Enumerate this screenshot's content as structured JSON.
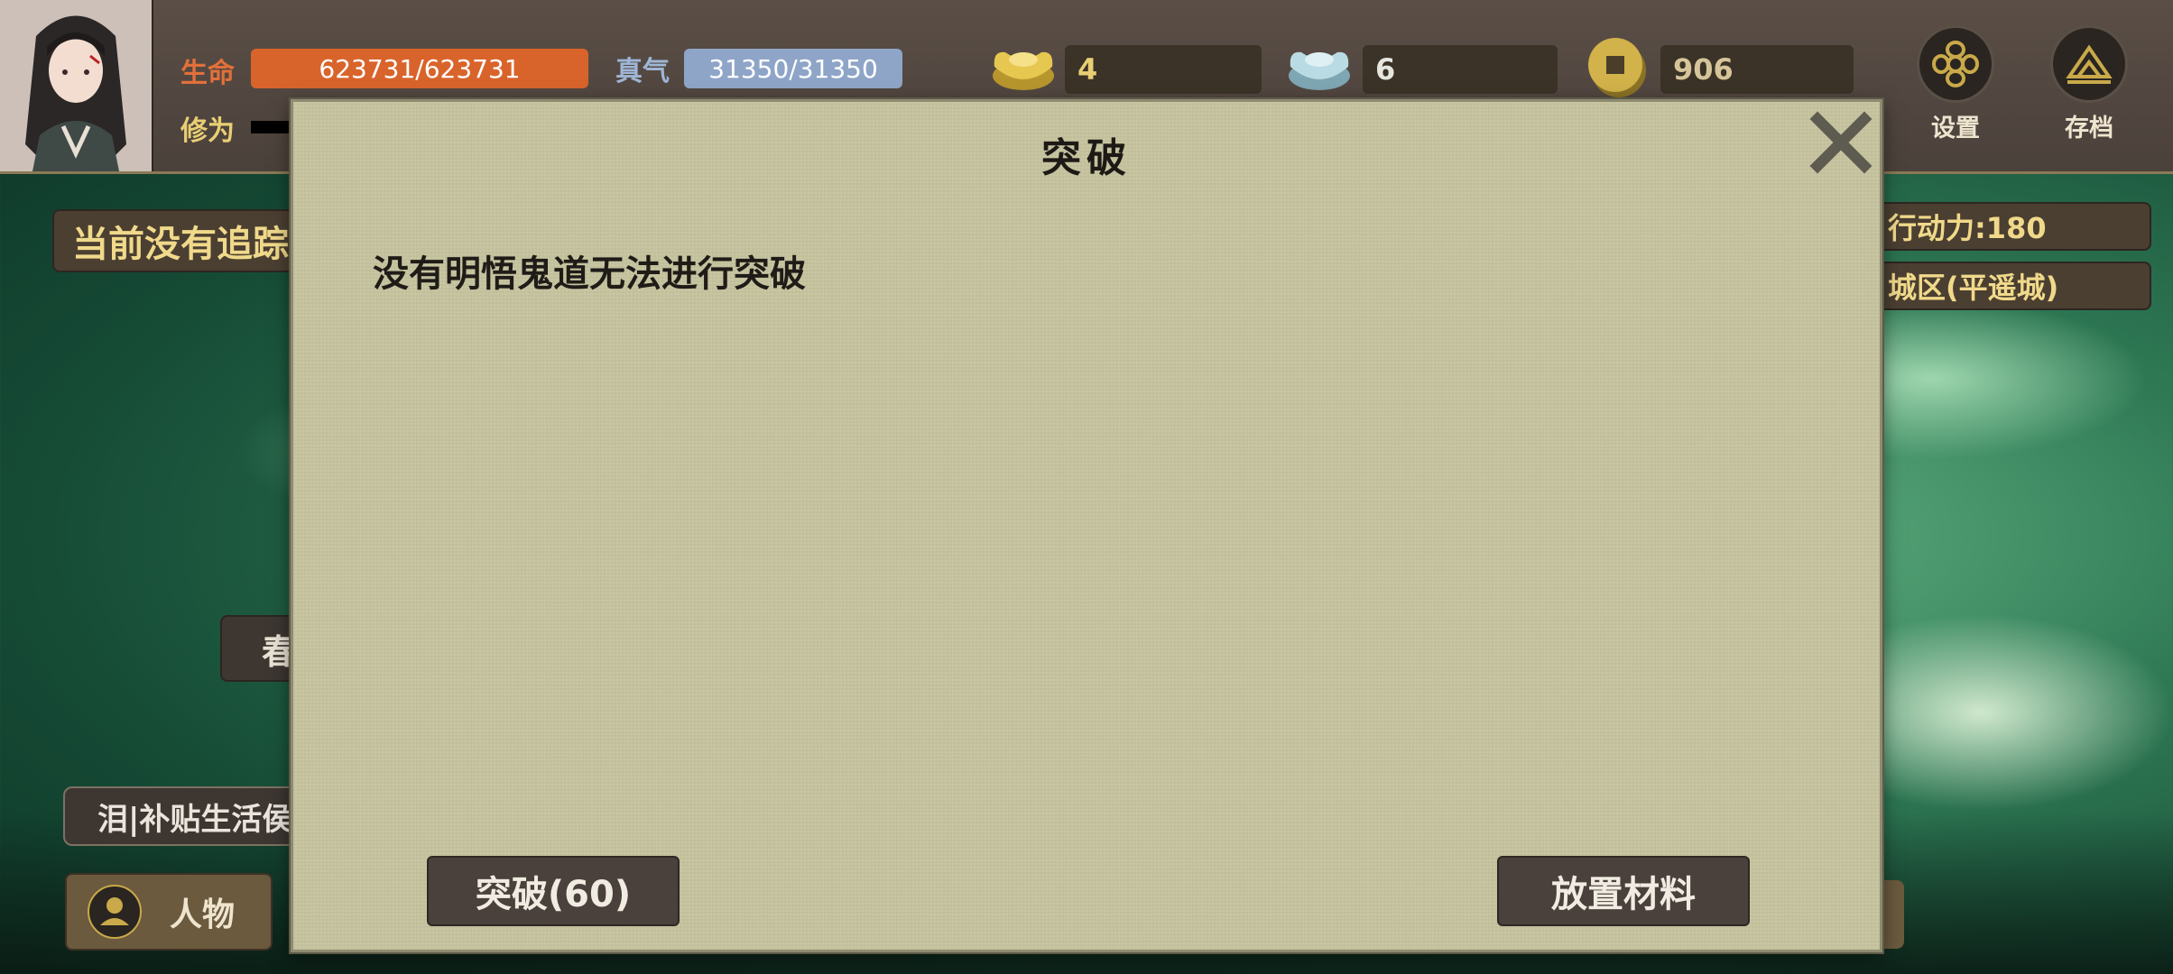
{
  "player": {
    "hp_label": "生命",
    "hp_value": "623731/623731",
    "qi_label": "真气",
    "qi_value": "31350/31350",
    "cultivation_label": "修为"
  },
  "currency": [
    {
      "icon": "gold-ingot-icon",
      "value": "4"
    },
    {
      "icon": "silver-ingot-icon",
      "value": "6"
    },
    {
      "icon": "copper-coin-icon",
      "value": "906"
    }
  ],
  "top_buttons": {
    "settings_label": "设置",
    "save_label": "存档"
  },
  "left_panel": {
    "tracking_text": "当前没有追踪",
    "side_button_text": "春",
    "subsidy_text": "泪|补贴生活侯"
  },
  "right_panel": {
    "stamina_text": "行动力:180",
    "location_text": "城区(平遥城)"
  },
  "bottom_nav": {
    "character_label": "人物"
  },
  "modal": {
    "title": "突破",
    "message": "没有明悟鬼道无法进行突破",
    "breakthrough_button": "突破(60)",
    "place_material_button": "放置材料"
  },
  "colors": {
    "hp_bar": "#d9642b",
    "qi_bar": "#8ea5c8",
    "gold_text": "#e9cf73",
    "modal_bg": "#c9c6a2",
    "modal_button": "#4a403c"
  }
}
